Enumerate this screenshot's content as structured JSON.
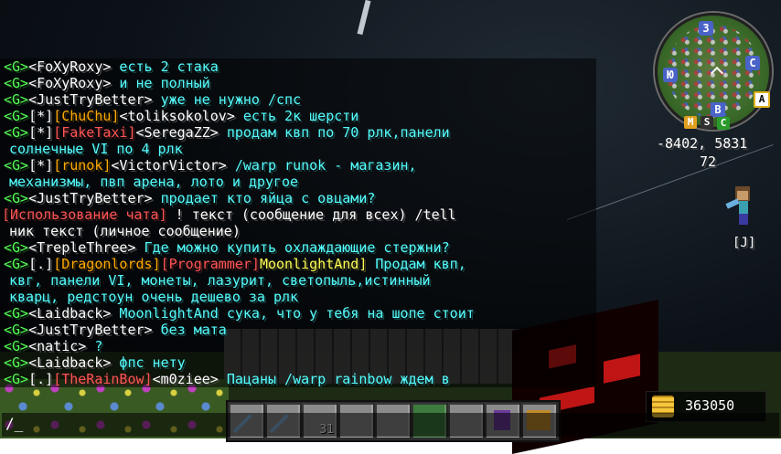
{
  "chat": {
    "lines": [
      {
        "tag": "<G>",
        "name": "<FoXyRoxy>",
        "text": " есть 2 стака"
      },
      {
        "tag": "<G>",
        "name": "<FoXyRoxy>",
        "text": " и не полный"
      },
      {
        "tag": "<G>",
        "name": "<JustTryBetter>",
        "text": " уже не нужно /спс"
      },
      {
        "tag": "<G>",
        "rank": "[*]",
        "group": "[ChuChu]",
        "name": "<toliksokolov>",
        "text": " есть 2к шерсти"
      },
      {
        "tag": "<G>",
        "rank": "[*]",
        "group": "[FakeTaxi]",
        "name": "<SeregaZZ>",
        "text": " продам квп по 70 рлк,панели"
      },
      {
        "text": "солнечные VI по 4 рлк"
      },
      {
        "tag": "<G>",
        "rank": "[*]",
        "group": "[runok]",
        "name": "<VictorVictor>",
        "text": " /warp runok - магазин,"
      },
      {
        "text": "механизмы, пвп арена, лото и другое"
      },
      {
        "tag": "<G>",
        "name": "<JustTryBetter>",
        "text": " продает кто яйца с овцами?"
      },
      {
        "system": "[Использование чата]",
        "text": " ! текст (сообщение для всех) /tell"
      },
      {
        "text": "ник текст  (личное сообщение)"
      },
      {
        "tag": "<G>",
        "name": "<TrepleThree>",
        "text": " Где можно купить охлаждающие стержни?"
      },
      {
        "tag": "<G>",
        "rank": "[.]",
        "group": "[Dragonlords]",
        "role": "[Programmer]",
        "name": "MoonlightAnd]",
        "text": " Продам квп,"
      },
      {
        "text": "квг, панели VI, монеты, лазурит, светопыль,истинный"
      },
      {
        "text": "кварц, редстоун очень дешево за рлк"
      },
      {
        "tag": "<G>",
        "name": "<Laidback>",
        "text": " MoonlightAnd сука, что у тебя на шопе стоит"
      },
      {
        "tag": "<G>",
        "name": "<JustTryBetter>",
        "text": " без мата"
      },
      {
        "tag": "<G>",
        "name": "<natic>",
        "text": " ?"
      },
      {
        "tag": "<G>",
        "name": "<Laidback>",
        "text": " фпс нету"
      },
      {
        "tag": "<G>",
        "rank": "[.]",
        "group": "[TheRainBow]",
        "name": "<m0ziee>",
        "text": " Пацаны /warp rainbow ждем в"
      }
    ]
  },
  "minimap": {
    "compass": {
      "north": "З",
      "west": "Ю",
      "east": "С",
      "south": "В"
    },
    "waypoints": [
      "A",
      "M",
      "S",
      "C"
    ],
    "coords": "-8402, 5831",
    "height": "72"
  },
  "hud": {
    "avatar_hotkey": "[J]",
    "money": "363050",
    "hotbar_count": "31",
    "chat_prompt": "/_"
  },
  "colors": {
    "chat_default": "#55ffff",
    "tag": "#55ff55",
    "group": "#ffaa00",
    "system": "#ff5555",
    "minimap_compass": "#4a63c8"
  }
}
